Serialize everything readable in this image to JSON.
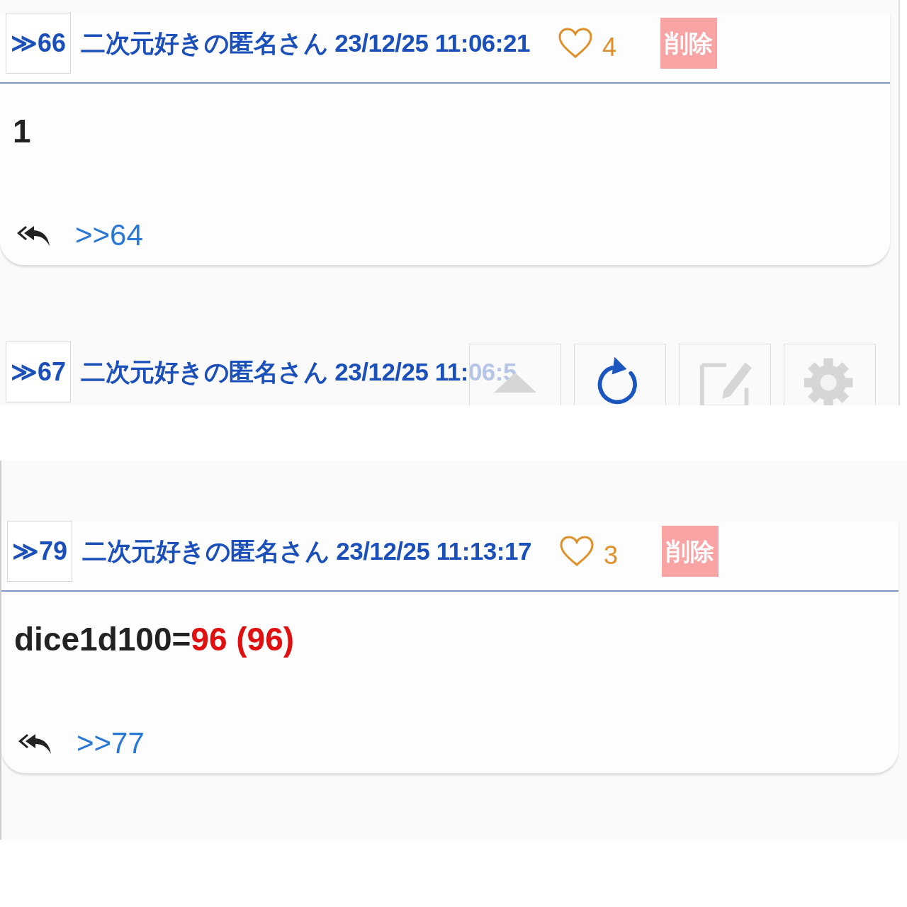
{
  "posts": [
    {
      "number": "≫66",
      "name": "二次元好きの匿名さん",
      "date": "23/12/25 11:06:21",
      "likes": "4",
      "delete": "削除",
      "body": [
        {
          "kind": "plain",
          "text": "1"
        }
      ],
      "reply_link": ">>64"
    },
    {
      "number": "≫79",
      "name": "二次元好きの匿名さん",
      "date": "23/12/25 11:13:17",
      "likes": "3",
      "delete": "削除",
      "body": [
        {
          "kind": "plain",
          "text": "dice1d100="
        },
        {
          "kind": "result",
          "text": "96 (96)"
        }
      ],
      "reply_link": ">>77"
    }
  ],
  "partial_post": {
    "number": "≫67",
    "name": "二次元好きの匿名さん",
    "date": "23/12/25 11:06:5"
  },
  "toolbar": [
    {
      "kind": "up"
    },
    {
      "kind": "refresh"
    },
    {
      "kind": "edit"
    },
    {
      "kind": "settings"
    }
  ]
}
